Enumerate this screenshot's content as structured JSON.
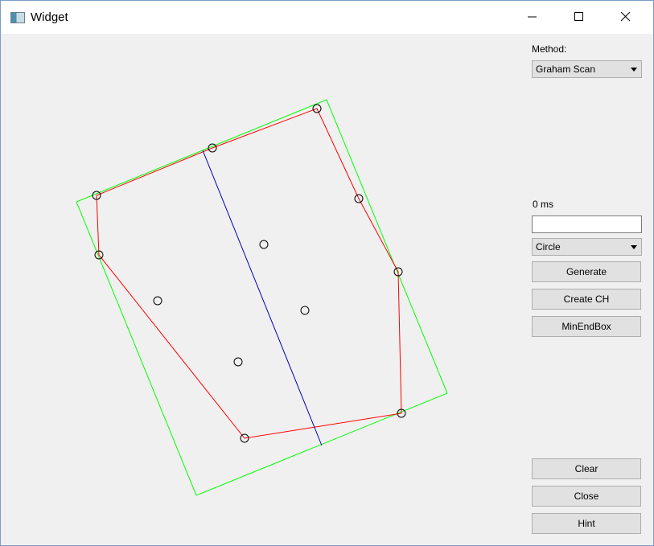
{
  "window": {
    "title": "Widget"
  },
  "controls": {
    "method_label": "Method:",
    "method_value": "Graham Scan",
    "time_label": "0 ms",
    "time_input_value": "",
    "shape_value": "Circle",
    "generate_label": "Generate",
    "create_ch_label": "Create CH",
    "minendbox_label": "MinEndBox",
    "clear_label": "Clear",
    "close_label": "Close",
    "hint_label": "Hint"
  },
  "colors": {
    "hull": "#ff0000",
    "bounding_box": "#00ff00",
    "axis": "#0000c0",
    "points": "#000000"
  }
}
